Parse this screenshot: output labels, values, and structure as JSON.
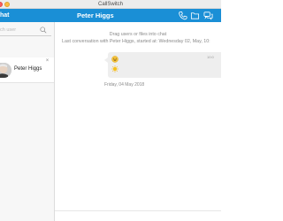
{
  "window": {
    "title": "CallSwitch"
  },
  "header": {
    "left_label": "hat",
    "contact_name": "Peter Higgs",
    "icons": [
      "phone-icon",
      "folder-icon",
      "chat-bubbles-icon"
    ],
    "brand_color": "#1a8fd6"
  },
  "sidebar": {
    "search": {
      "placeholder": "ch user",
      "value": ""
    },
    "contacts": [
      {
        "name": "Peter Higgs",
        "icon": "close-icon"
      }
    ]
  },
  "chat": {
    "drag_hint": "Drag users or files into chat",
    "started_text": "Last conversation with Peter Higgs, started at: Wednesday 02, May, 10:",
    "message": {
      "emojis": [
        "grinning-face-emoji",
        "sun-emoji"
      ],
      "time": "10:0"
    },
    "date_separator": "Friday, 04 May 2018"
  }
}
